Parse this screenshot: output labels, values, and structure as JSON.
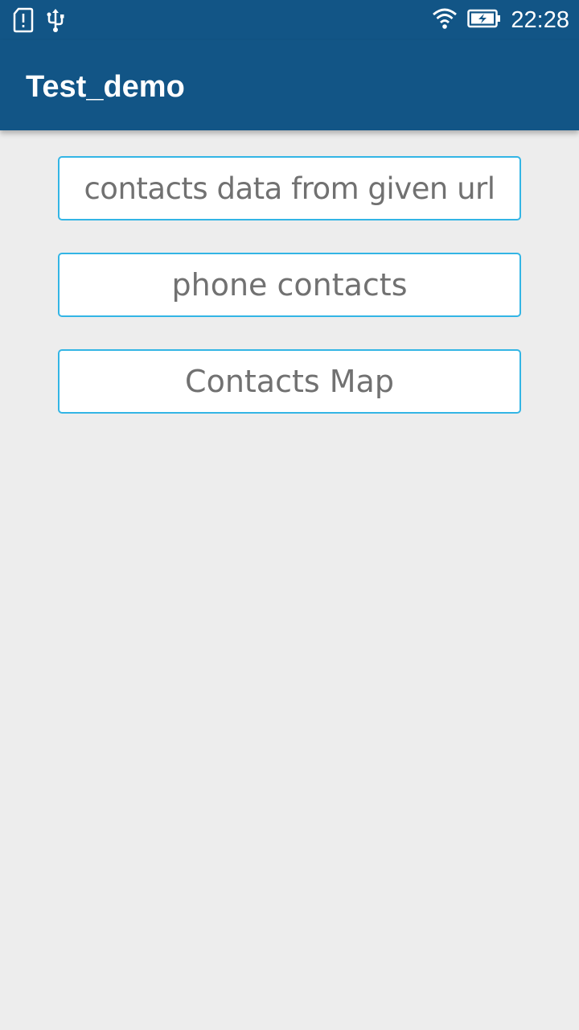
{
  "status_bar": {
    "time": "22:28",
    "icons": [
      "sim-alert-icon",
      "usb-icon",
      "wifi-icon",
      "battery-charging-icon"
    ]
  },
  "app_bar": {
    "title": "Test_demo",
    "color": "#125586"
  },
  "buttons": [
    {
      "label": "contacts data from given url"
    },
    {
      "label": "phone contacts"
    },
    {
      "label": "Contacts Map"
    }
  ],
  "colors": {
    "background": "#ededed",
    "button_border": "#33b5e5",
    "button_text": "#717171"
  }
}
